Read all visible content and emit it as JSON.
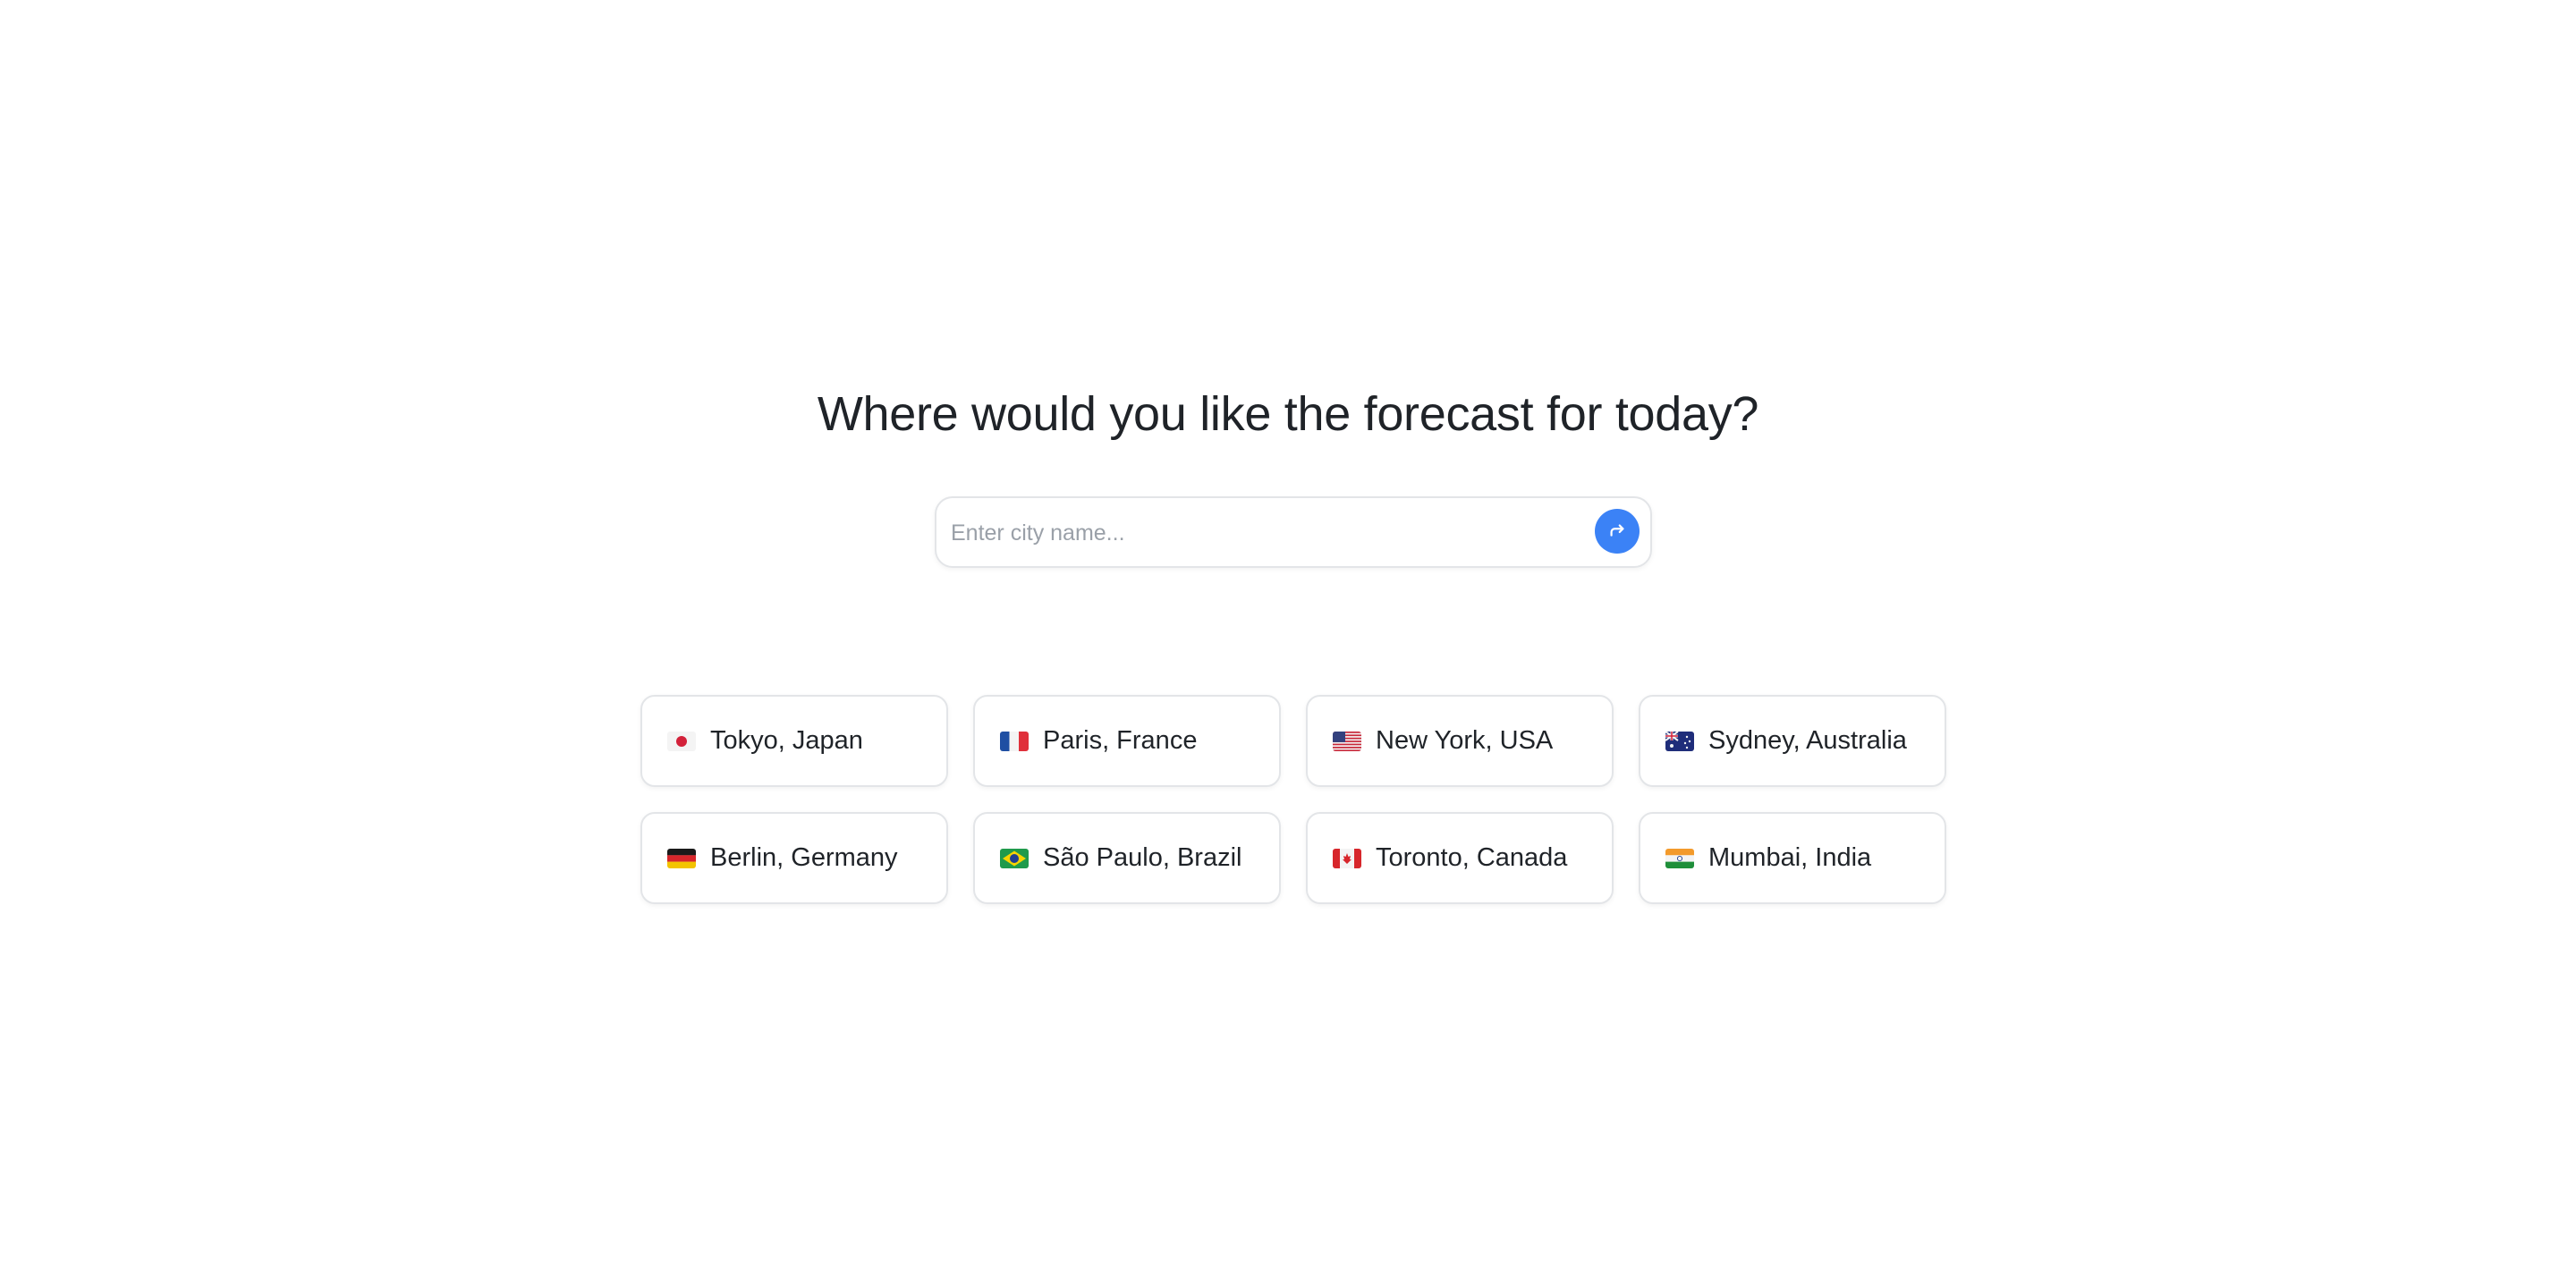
{
  "heading": "Where would you like the forecast for today?",
  "search": {
    "value": "",
    "placeholder": "Enter city name..."
  },
  "colors": {
    "accent": "#3b82f6",
    "border": "#e3e5e8",
    "text": "#1f2328",
    "placeholder": "#9aa0a8"
  },
  "cities": [
    {
      "label": "Tokyo, Japan",
      "flag": "japan-flag-icon"
    },
    {
      "label": "Paris, France",
      "flag": "france-flag-icon"
    },
    {
      "label": "New York, USA",
      "flag": "usa-flag-icon"
    },
    {
      "label": "Sydney, Australia",
      "flag": "australia-flag-icon"
    },
    {
      "label": "Berlin, Germany",
      "flag": "germany-flag-icon"
    },
    {
      "label": "São Paulo, Brazil",
      "flag": "brazil-flag-icon"
    },
    {
      "label": "Toronto, Canada",
      "flag": "canada-flag-icon"
    },
    {
      "label": "Mumbai, India",
      "flag": "india-flag-icon"
    }
  ]
}
